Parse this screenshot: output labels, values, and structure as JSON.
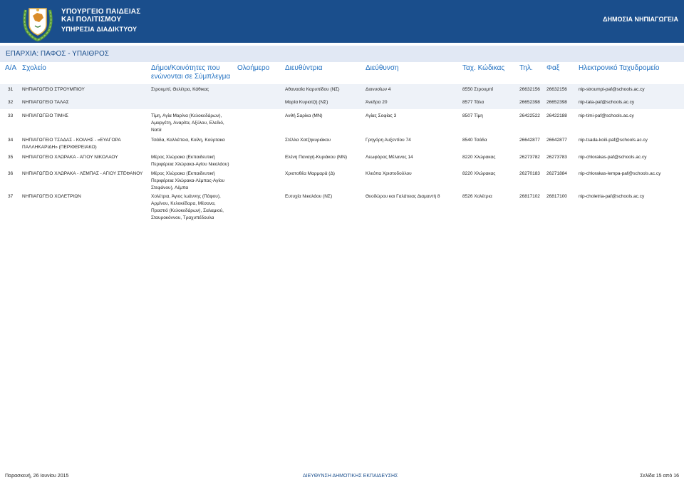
{
  "header": {
    "ministry_line1": "ΥΠΟΥΡΓΕΙΟ ΠΑΙΔΕΙΑΣ",
    "ministry_line2": "ΚΑΙ ΠΟΛΙΤΙΣΜΟΥ",
    "service": "ΥΠΗΡΕΣΙΑ ΔΙΑΔΙΚΤΥΟΥ",
    "department": "ΔΗΜΟΣΙΑ ΝΗΠΙΑΓΩΓΕΙΑ",
    "brand_color": "#1a4e8c"
  },
  "district": "ΕΠΑΡΧΙΑ: ΠΑΦΟΣ - ΥΠΑΙΘΡΟΣ",
  "columns": {
    "aa": "Α/Α",
    "school": "Σχολείο",
    "communities_1": "Δήμοι/Κοινότητες που",
    "communities_2": "ενώνονται σε Σύμπλεγμα",
    "day": "Ολοήμερο",
    "principal": "Διευθύντρια",
    "address": "Διεύθυνση",
    "postal": "Ταχ. Κώδικας",
    "phone": "Τηλ.",
    "fax": "Φαξ",
    "email": "Ηλεκτρονικό Ταχυδρομείο"
  },
  "rows": [
    {
      "aa": "31",
      "school": [
        "ΝΗΠΙΑΓΩΓΕΙΟ ΣΤΡΟΥΜΠΙΟΥ"
      ],
      "communities": [
        "Στρουμπί, Θελέτρα, Κάθικας"
      ],
      "principal": "Αθανασία Καρυπίδου (ΝΣ)",
      "address": "Διονυσίων 4",
      "postal": "8550 Στρουμπί",
      "phone": "26632156",
      "fax": "26632156",
      "email": "nip-stroumpi-paf@schools.ac.cy"
    },
    {
      "aa": "32",
      "school": [
        "ΝΗΠΙΑΓΩΓΕΙΟ ΤΑΛΑΣ"
      ],
      "communities": [],
      "principal": "Μαρία Κυριατζή (ΝΣ)",
      "address": "Άνεδρα 20",
      "postal": "8577 Τάλα",
      "phone": "26652398",
      "fax": "26652398",
      "email": "nip-tala-paf@schools.ac.cy"
    },
    {
      "aa": "33",
      "school": [
        "ΝΗΠΙΑΓΩΓΕΙΟ ΤΙΜΗΣ"
      ],
      "communities": [
        "Τίμη, Αγία Μαρίνα (Κελοκεδάρων),",
        "Αμαργέτη, Αναρίτα, Αξύλου, Ελεδιό,",
        "Νατά"
      ],
      "principal": "Ανθή Σαρίκα (ΜΝ)",
      "address": "Αγίας Σοφίας 3",
      "postal": "8507 Τίμη",
      "phone": "26422522",
      "fax": "26422188",
      "email": "nip-timi-paf@schools.ac.cy"
    },
    {
      "aa": "34",
      "school": [
        "ΝΗΠΙΑΓΩΓΕΙΟ ΤΣΑΔΑΣ - ΚΟΙΛΗΣ - «ΕΥΑΓΟΡΑ",
        "ΠΑΛΛΗΚΑΡΙΔΗ» (ΠΕΡΙΦΕΡΕΙΑΚΟ)"
      ],
      "communities": [
        "Τσάδα, Καλλέπεια, Κοίλη, Κούρτακα"
      ],
      "principal": "Στέλλα Χατζηκυριάκου",
      "address": "Γρηγόρη Αυξεντίου 74",
      "postal": "8540 Τσάδα",
      "phone": "26642877",
      "fax": "26642877",
      "email": "nip-tsada-koili-paf@schools.ac.cy"
    },
    {
      "aa": "35",
      "school": [
        "ΝΗΠΙΑΓΩΓΕΙΟ ΧΛΩΡΑΚΑ - ΑΓΙΟΥ ΝΙΚΟΛΑΟΥ"
      ],
      "communities": [
        "Μέρος Χλώρακα (Εκπαιδευτική",
        "Περιφέρεια Χλώρακα-Αγίου Νικολάου)"
      ],
      "principal": "Ελένη Παναγή-Κυριάκου (ΜΝ)",
      "address": "Λεωφόρος Μέλανος 14",
      "postal": "8220 Χλώρακας",
      "phone": "26273782",
      "fax": "26273783",
      "email": "nip-chlorakas-paf@schools.ac.cy"
    },
    {
      "aa": "36",
      "school": [
        "ΝΗΠΙΑΓΩΓΕΙΟ ΧΛΩΡΑΚΑ - ΛΕΜΠΑΣ - ΑΓΙΟΥ ΣΤΕΦΑΝΟΥ"
      ],
      "communities": [
        "Μέρος Χλώρακα (Εκπαιδευτική",
        "Περιφέρεια Χλώρακα-Λέμπας-Αγίου",
        "Στεφάνου), Λέμπα"
      ],
      "principal": "Χριστοθέα Μαρμαρά (Δ)",
      "address": "Κλεόπα Χριστοδούλου",
      "postal": "8220 Χλώρακας",
      "phone": "26270183",
      "fax": "26271884",
      "email": "nip-chlorakas-lempa-paf@schools.ac.cy"
    },
    {
      "aa": "37",
      "school": [
        "ΝΗΠΙΑΓΩΓΕΙΟ ΧΟΛΕΤΡΙΩΝ"
      ],
      "communities": [
        "Χολέτρια, Άγιος Ιωάννης (Πάφου),",
        "Αρμίνου, Κελοκέδαρα, Μέσανα,",
        "Πραστιό (Κελοκεδάρων), Σαλαμιού,",
        "Σταυροκόννου, Τραχυπέδουλα"
      ],
      "principal": "Ευτυχία Νικολάου (ΝΣ)",
      "address": "Θεοδώρου και Γαλάτειας Διαμαντή 8",
      "postal": "8526 Χολέτρια",
      "phone": "26817102",
      "fax": "26817100",
      "email": "nip-choletria-paf@schools.ac.cy"
    }
  ],
  "footer": {
    "date": "Παρασκευή, 26 Ιουνίου 2015",
    "center": "ΔΙΕΥΘΥΝΣΗ ΔΗΜΟΤΙΚΗΣ ΕΚΠΑΙΔΕΥΣΗΣ",
    "page": "Σελίδα 15 από 16"
  }
}
